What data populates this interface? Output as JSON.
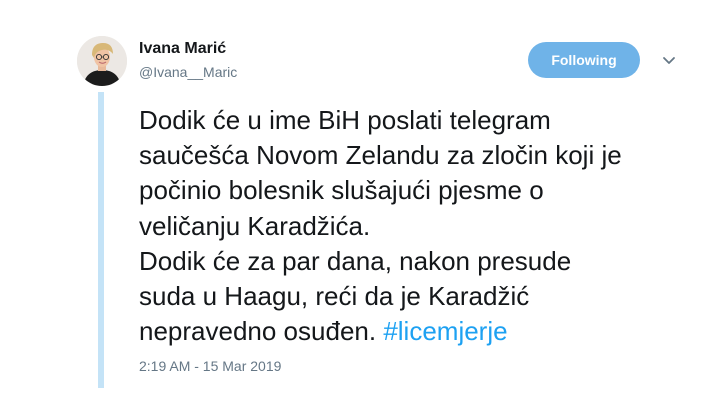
{
  "author": {
    "name": "Ivana Marić",
    "handle": "@Ivana__Maric"
  },
  "follow_button": {
    "label": "Following"
  },
  "tweet": {
    "lines": [
      "Dodik će u ime BiH poslati telegram",
      "saučešća Novom Zelandu za zločin koji je",
      "počinio bolesnik slušajući pjesme o",
      "veličanju Karadžića.",
      "Dodik će za par dana, nakon presude",
      "suda u Haagu, reći da je Karadžić"
    ],
    "last_line_text": "nepravedno osuđen. ",
    "hashtag": "#licemjerje"
  },
  "timestamp": "2:19 AM - 15 Mar 2019",
  "icons": {
    "avatar": "profile-photo",
    "menu": "chevron-down-icon"
  },
  "colors": {
    "accent": "#1da1f2",
    "follow_button_bg": "#6fb3e8",
    "thread_line": "#c4e3f7",
    "secondary_text": "#657786"
  }
}
